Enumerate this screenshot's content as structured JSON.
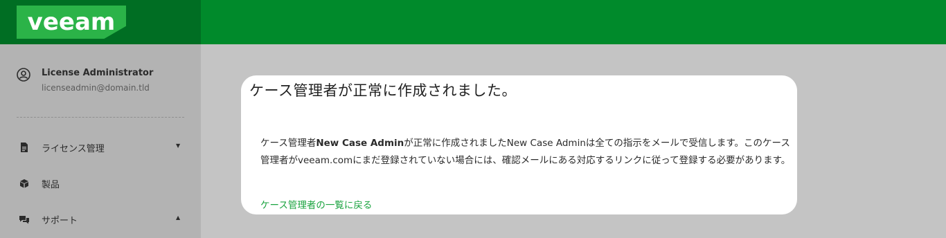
{
  "brand": {
    "logo_text": "veeam",
    "topbar_color": "#008a2b",
    "logo_bg_color": "#006e23",
    "logo_color": "#2bb348"
  },
  "user": {
    "name": "License Administrator",
    "email": "licenseadmin@domain.tld",
    "icon": "user-circle-icon"
  },
  "sidebar": {
    "items": [
      {
        "label": "ライセンス管理",
        "icon": "document-icon",
        "caret": "▼"
      },
      {
        "label": "製品",
        "icon": "cube-icon",
        "caret": ""
      },
      {
        "label": "サポート",
        "icon": "chat-icon",
        "caret": "▲"
      }
    ]
  },
  "dialog": {
    "title": "ケース管理者が正常に作成されました。",
    "body_part1": "ケース管理者",
    "body_bold1": "New Case Admin",
    "body_part2": "が正常に作成されましたNew Case Adminは全ての指示をメールで受信します。このケース管理者がveeam.comにまだ登録されていない場合には、確認メールにある対応するリンクに従って登録する必要があります。",
    "link": "ケース管理者の一覧に戻る",
    "link_color": "#1aa33f"
  }
}
